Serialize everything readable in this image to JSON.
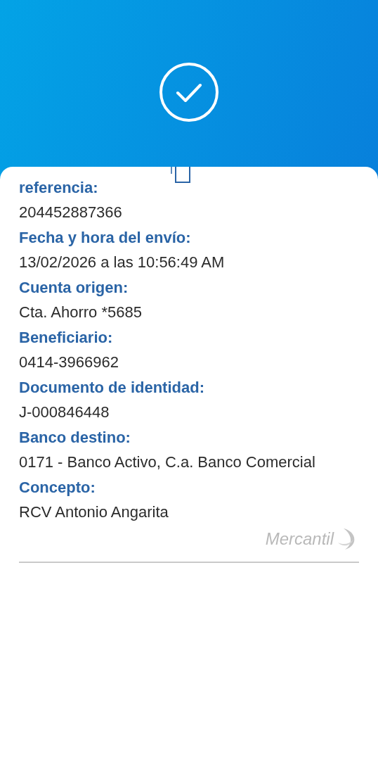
{
  "details": [
    {
      "label": "referencia:",
      "value": "204452887366"
    },
    {
      "label": "Fecha y hora del envío:",
      "value": "13/02/2026 a las 10:56:49 AM"
    },
    {
      "label": "Cuenta origen:",
      "value": "Cta. Ahorro *5685"
    },
    {
      "label": "Beneficiario:",
      "value": "0414-3966962"
    },
    {
      "label": "Documento de identidad:",
      "value": "J-000846448"
    },
    {
      "label": "Banco destino:",
      "value": "0171 - Banco Activo, C.a. Banco Comercial"
    },
    {
      "label": "Concepto:",
      "value": "RCV Antonio Angarita"
    }
  ],
  "brand": {
    "name": "Mercantil"
  }
}
